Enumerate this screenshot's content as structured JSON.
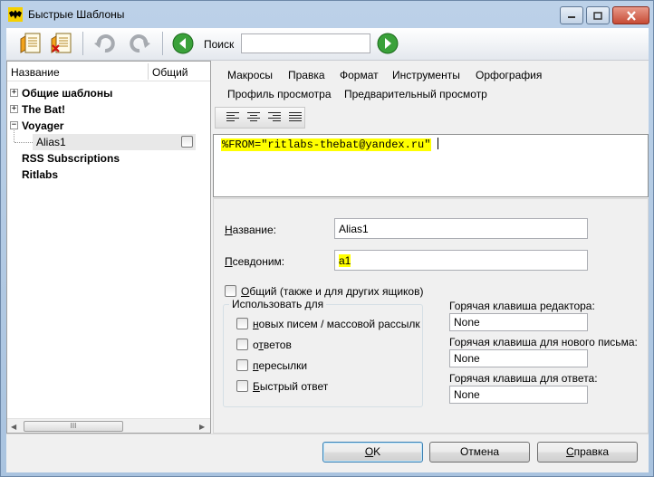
{
  "window": {
    "title": "Быстрые Шаблоны"
  },
  "toolbar": {
    "search_label": "Поиск",
    "search_value": ""
  },
  "tree": {
    "col_name": "Название",
    "col_shared": "Общий",
    "items": [
      {
        "label": "Общие шаблоны",
        "expander": "+"
      },
      {
        "label": "The Bat!",
        "expander": "+"
      },
      {
        "label": "Voyager",
        "expander": "−"
      },
      {
        "label": "Alias1",
        "shared": false
      },
      {
        "label": "RSS Subscriptions"
      },
      {
        "label": "Ritlabs"
      }
    ],
    "scroll_grip": "III"
  },
  "menu": {
    "row1": [
      "Макросы",
      "Правка",
      "Формат",
      "Инструменты",
      "Орфография"
    ],
    "row2": [
      "Профиль просмотра",
      "Предварительный просмотр"
    ]
  },
  "editor": {
    "text": "%FROM=\"ritlabs-thebat@yandex.ru\""
  },
  "form": {
    "name_label": "Название:",
    "name_value": "Alias1",
    "alias_label": "Псевдоним:",
    "alias_value": "a1",
    "shared_label": "Общий (также и для других ящиков)",
    "shared_checked": false,
    "use_for_title": "Использовать для",
    "use_for": [
      {
        "label": "новых писем / массовой рассылк",
        "checked": false
      },
      {
        "label": "ответов",
        "checked": false
      },
      {
        "label": "пересылки",
        "checked": false
      },
      {
        "label": "Быстрый ответ",
        "checked": false
      }
    ],
    "hotkey_editor_label": "Горячая клавиша редактора:",
    "hotkey_editor_value": "None",
    "hotkey_new_label": "Горячая клавиша для нового письма:",
    "hotkey_new_value": "None",
    "hotkey_reply_label": "Горячая клавиша для ответа:",
    "hotkey_reply_value": "None"
  },
  "buttons": {
    "ok": "OK",
    "cancel": "Отмена",
    "help": "Справка"
  },
  "colors": {
    "highlight": "#ffff00",
    "nav_green": "#2e9a2e"
  }
}
